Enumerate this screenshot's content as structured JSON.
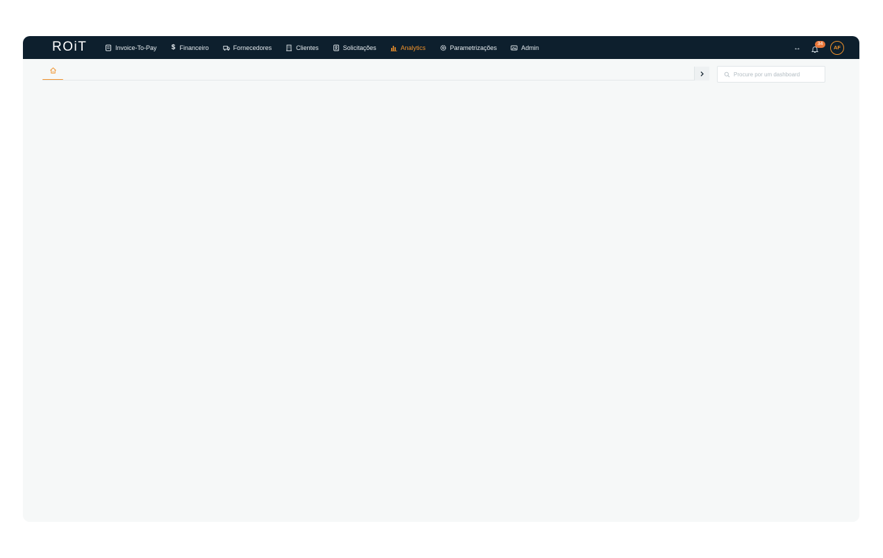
{
  "brand": {
    "logo_text": "ROiT"
  },
  "nav": {
    "items": [
      {
        "label": "Invoice-To-Pay",
        "icon": "invoice-icon",
        "active": false
      },
      {
        "label": "Financeiro",
        "icon": "dollar-icon",
        "active": false
      },
      {
        "label": "Fornecedores",
        "icon": "truck-icon",
        "active": false
      },
      {
        "label": "Clientes",
        "icon": "building-icon",
        "active": false
      },
      {
        "label": "Solicitações",
        "icon": "request-icon",
        "active": false
      },
      {
        "label": "Analytics",
        "icon": "bar-chart-icon",
        "active": true
      },
      {
        "label": "Parametrizações",
        "icon": "gear-icon",
        "active": false
      },
      {
        "label": "Admin",
        "icon": "admin-icon",
        "active": false
      }
    ]
  },
  "header": {
    "expand_icon": "↔",
    "notifications_count": "34",
    "avatar_initials": "AF"
  },
  "search": {
    "placeholder": "Procure por um dashboard"
  },
  "colors": {
    "topbar": "#0d1f2d",
    "accent": "#f0922b",
    "badge": "#e9773a",
    "background": "#f6f8f8"
  }
}
